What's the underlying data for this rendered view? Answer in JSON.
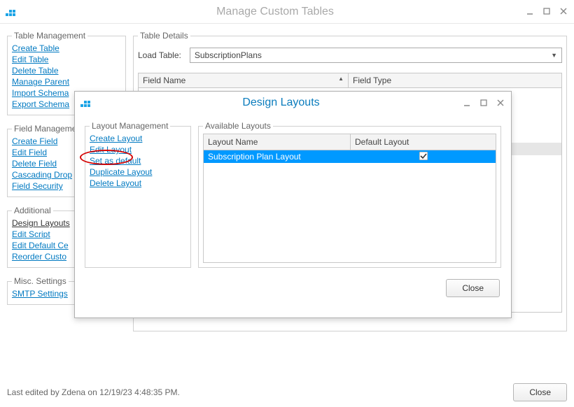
{
  "window": {
    "title": "Manage Custom Tables"
  },
  "sidebar": {
    "groups": {
      "table_mgmt": {
        "legend": "Table Management",
        "items": [
          "Create Table",
          "Edit Table",
          "Delete Table",
          "Manage Parent",
          "Import Schema",
          "Export Schema"
        ]
      },
      "field_mgmt": {
        "legend": "Field Management",
        "items": [
          "Create Field",
          "Edit Field",
          "Delete Field",
          "Cascading Drop",
          "Field Security"
        ]
      },
      "additional": {
        "legend": "Additional",
        "items": [
          "Design Layouts",
          "Edit Script",
          "Edit Default Ce",
          "Reorder Custo"
        ]
      },
      "misc": {
        "legend": "Misc. Settings",
        "items": [
          "SMTP Settings"
        ]
      }
    }
  },
  "details": {
    "legend": "Table Details",
    "load_label": "Load Table:",
    "selected_table": "SubscriptionPlans",
    "grid_columns": [
      "Field Name",
      "Field Type"
    ]
  },
  "modal": {
    "title": "Design Layouts",
    "layout_mgmt": {
      "legend": "Layout Management",
      "items": [
        "Create Layout",
        "Edit Layout",
        "Set as default",
        "Duplicate Layout",
        "Delete Layout"
      ]
    },
    "available": {
      "legend": "Available Layouts",
      "columns": [
        "Layout Name",
        "Default Layout"
      ],
      "rows": [
        {
          "name": "Subscription Plan Layout",
          "is_default": true
        }
      ]
    },
    "close_label": "Close"
  },
  "footer": {
    "status": "Last edited by Zdena on 12/19/23 4:48:35 PM.",
    "close": "Close"
  }
}
